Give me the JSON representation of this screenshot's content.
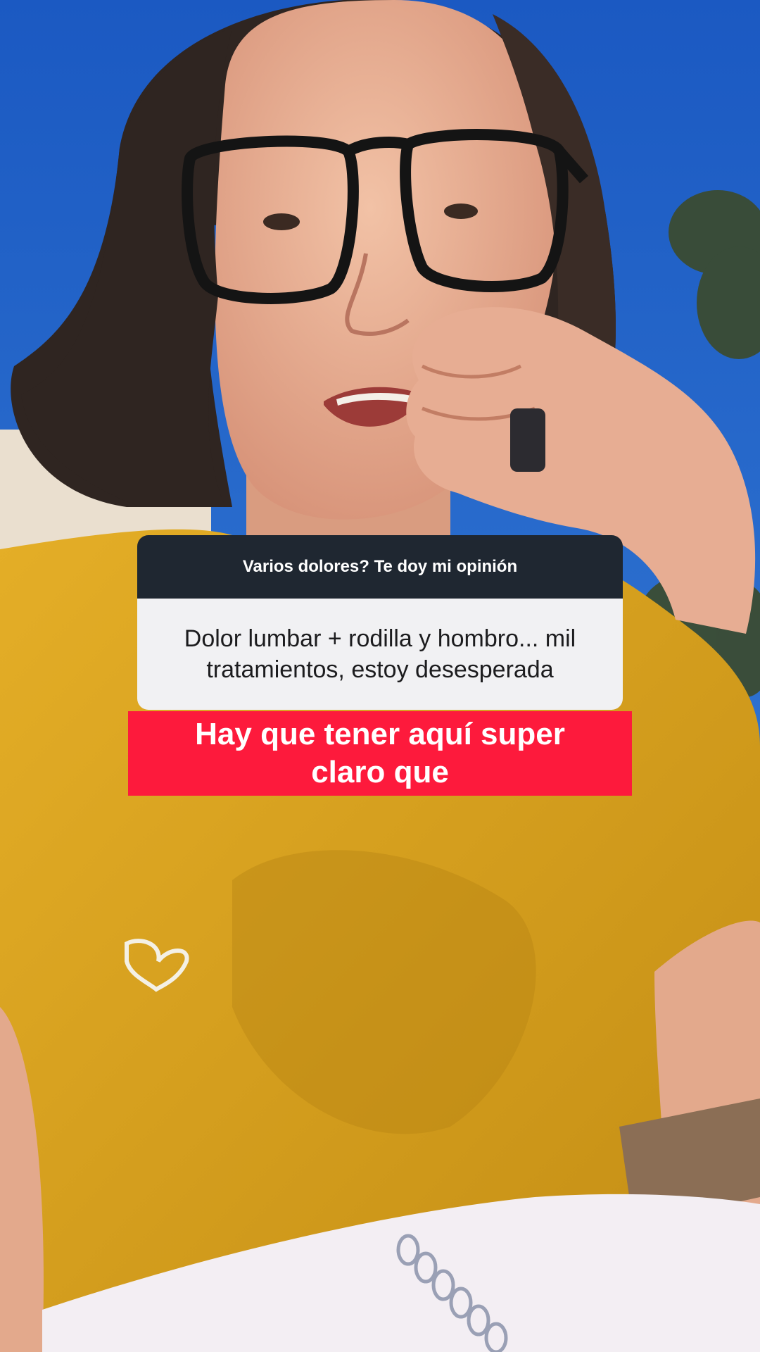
{
  "question_sticker": {
    "header": "Varios dolores? Te doy mi opinión",
    "answer": "Dolor lumbar + rodilla y hombro... mil tratamientos, estoy desesperada"
  },
  "caption": {
    "text": "Hay que tener aquí super claro que"
  },
  "colors": {
    "sky": "#1f5fc4",
    "shirt": "#d9a21c",
    "sticker_header": "#1f2731",
    "sticker_body": "#f1f1f3",
    "caption_bg": "#fd1a3c"
  }
}
